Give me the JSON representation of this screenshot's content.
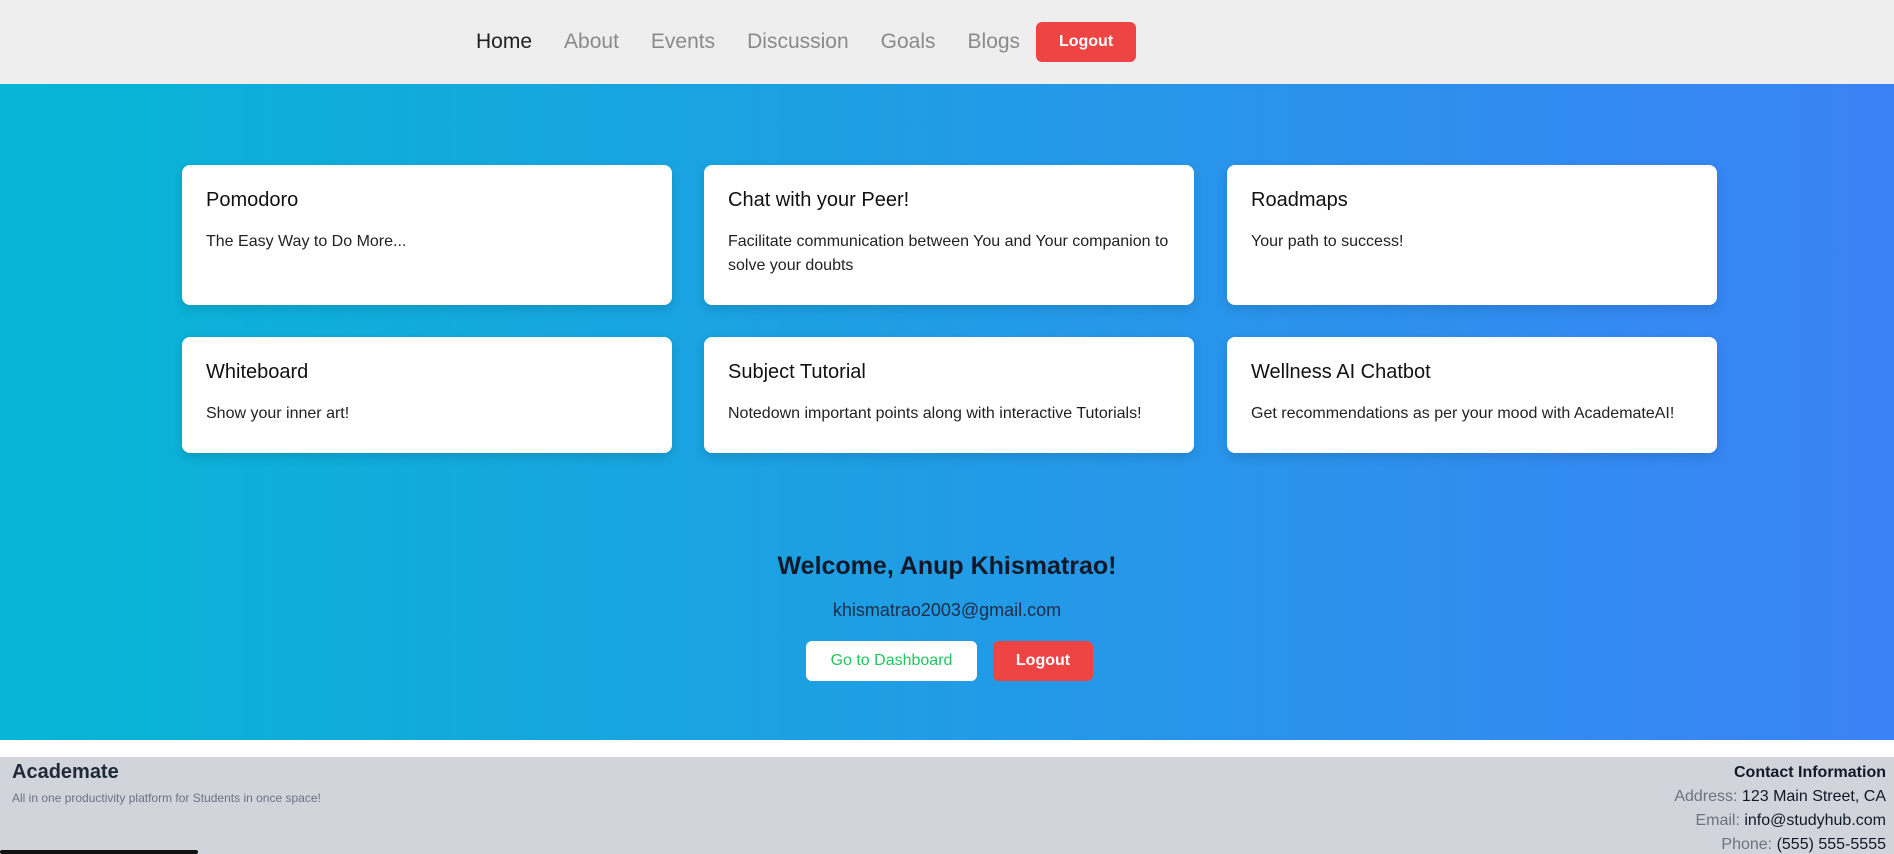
{
  "nav": {
    "links": [
      "Home",
      "About",
      "Events",
      "Discussion",
      "Goals",
      "Blogs"
    ],
    "logout_label": "Logout"
  },
  "cards": [
    {
      "title": "Pomodoro",
      "desc": "The Easy Way to Do More..."
    },
    {
      "title": "Chat with your Peer!",
      "desc": "Facilitate communication between You and Your companion to solve your doubts"
    },
    {
      "title": "Roadmaps",
      "desc": "Your path to success!"
    },
    {
      "title": "Whiteboard",
      "desc": "Show your inner art!"
    },
    {
      "title": "Subject Tutorial",
      "desc": "Notedown important points along with interactive Tutorials!"
    },
    {
      "title": "Wellness AI Chatbot",
      "desc": "Get recommendations as per your mood with AcademateAI!"
    }
  ],
  "welcome": {
    "greeting": "Welcome, Anup Khismatrao!",
    "email": "khismatrao2003@gmail.com",
    "dashboard_label": "Go to Dashboard",
    "logout_label": "Logout"
  },
  "footer": {
    "brand": "Academate",
    "tagline": "All in one productivity platform for Students in once space!",
    "contact_heading": "Contact Information",
    "address_label": "Address:",
    "address": "123 Main Street, CA",
    "email_label": "Email:",
    "email": "info@studyhub.com",
    "phone_label": "Phone:",
    "phone": "(555) 555-5555"
  },
  "colors": {
    "gradient_start": "#06b6d4",
    "gradient_end": "#3b82f6",
    "logout_red": "#ef4444",
    "dashboard_green": "#22c55e"
  }
}
